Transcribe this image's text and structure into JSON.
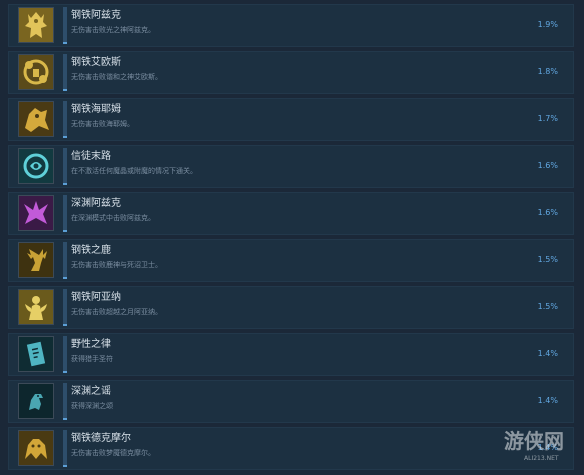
{
  "achievements": [
    {
      "title": "钢铁阿兹克",
      "description": "无伤害击败光之神阿兹克。",
      "percent": "1.9%",
      "icon": "golden-demon-statue-icon",
      "icon_bg": "#7a6520",
      "icon_fg": "#e2c45a",
      "progress": 0.019
    },
    {
      "title": "钢铁艾欧斯",
      "description": "无伤害击败谐和之神艾欧斯。",
      "percent": "1.8%",
      "icon": "golden-flower-demon-icon",
      "icon_bg": "#5a4a1a",
      "icon_fg": "#d8b84a",
      "progress": 0.018
    },
    {
      "title": "钢铁海耶姆",
      "description": "无伤害击败海耶姆。",
      "percent": "1.7%",
      "icon": "golden-beast-icon",
      "icon_bg": "#4a3a14",
      "icon_fg": "#d4a93c",
      "progress": 0.017
    },
    {
      "title": "信徒末路",
      "description": "在不激活任何魔晶或附魔的情况下通关。",
      "percent": "1.6%",
      "icon": "cyan-sigil-icon",
      "icon_bg": "#123a40",
      "icon_fg": "#5fd0d8",
      "progress": 0.016
    },
    {
      "title": "深渊阿兹克",
      "description": "在深渊模式中击败阿兹克。",
      "percent": "1.6%",
      "icon": "purple-demon-icon",
      "icon_bg": "#3a1a46",
      "icon_fg": "#c25ad8",
      "progress": 0.016
    },
    {
      "title": "钢铁之鹿",
      "description": "无伤害击败鹿神与死沼卫士。",
      "percent": "1.5%",
      "icon": "golden-stag-icon",
      "icon_bg": "#3e3210",
      "icon_fg": "#c9a235",
      "progress": 0.015
    },
    {
      "title": "钢铁阿亚纳",
      "description": "无伤害击败超越之月阿亚纳。",
      "percent": "1.5%",
      "icon": "golden-moon-goddess-icon",
      "icon_bg": "#6a5a1c",
      "icon_fg": "#e6cf66",
      "progress": 0.015
    },
    {
      "title": "野性之律",
      "description": "获得猎手圣符",
      "percent": "1.4%",
      "icon": "teal-rune-tablet-icon",
      "icon_bg": "#0f2c33",
      "icon_fg": "#4fb5c2",
      "progress": 0.014
    },
    {
      "title": "深渊之谣",
      "description": "获得深渊之颂",
      "percent": "1.4%",
      "icon": "teal-raven-icon",
      "icon_bg": "#0d262d",
      "icon_fg": "#4aa6b2",
      "progress": 0.014
    },
    {
      "title": "钢铁德克摩尔",
      "description": "无伤害击败梦魇德克摩尔。",
      "percent": "1.4%",
      "icon": "golden-nightmare-icon",
      "icon_bg": "#4a3a12",
      "icon_fg": "#d2a638",
      "progress": 0.014
    }
  ],
  "watermark": {
    "text": "游侠网",
    "sub": "ALI213.NET"
  }
}
